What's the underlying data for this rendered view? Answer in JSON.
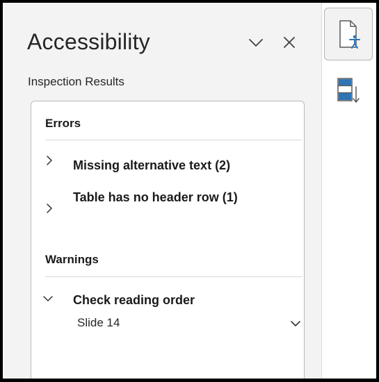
{
  "pane": {
    "title": "Accessibility",
    "subtitle": "Inspection Results",
    "collapse_icon": "chevron-down-icon",
    "close_icon": "close-icon"
  },
  "results": {
    "errors": {
      "header": "Errors",
      "items": [
        {
          "label": "Missing alternative text (2)",
          "expanded": false
        },
        {
          "label": "Table has no header row (1)",
          "expanded": false
        }
      ]
    },
    "warnings": {
      "header": "Warnings",
      "items": [
        {
          "label": "Check reading order",
          "expanded": true,
          "children": [
            {
              "label": "Slide 14"
            }
          ]
        }
      ]
    }
  },
  "rail": {
    "accessibility_icon": "accessibility-document-icon",
    "reading_order_icon": "reading-order-icon"
  },
  "colors": {
    "pane_background": "#f3f3f3",
    "box_background": "#ffffff",
    "box_border": "#b9b9b9",
    "icon_blue": "#2e75b6",
    "icon_gray": "#595959"
  }
}
